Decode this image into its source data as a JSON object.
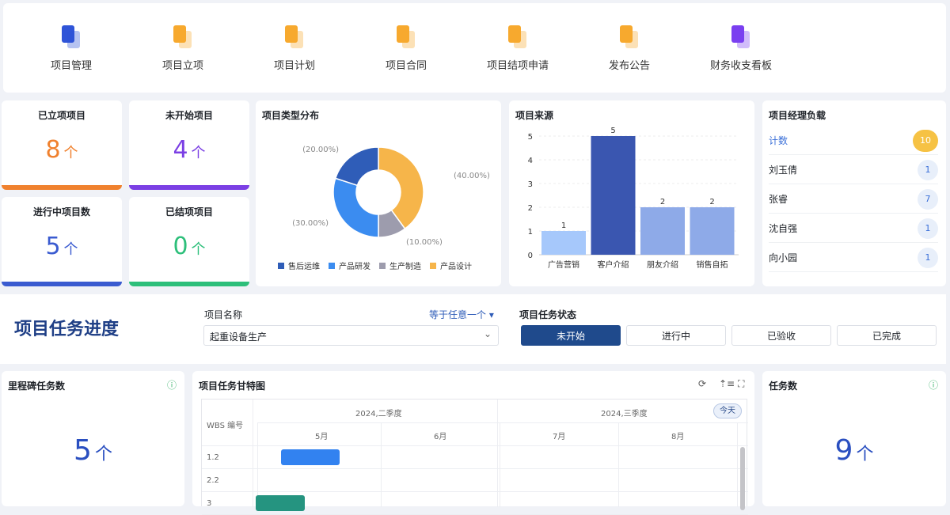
{
  "nav": [
    {
      "label": "项目管理",
      "icon": "project-management-icon",
      "color": "#2f54d8"
    },
    {
      "label": "项目立项",
      "icon": "project-initiation-icon",
      "color": "#f7a92e"
    },
    {
      "label": "项目计划",
      "icon": "project-plan-icon",
      "color": "#f7a92e"
    },
    {
      "label": "项目合同",
      "icon": "project-contract-icon",
      "color": "#f7a92e"
    },
    {
      "label": "项目结项申请",
      "icon": "project-closure-icon",
      "color": "#f7a92e"
    },
    {
      "label": "发布公告",
      "icon": "announcement-icon",
      "color": "#f7a92e"
    },
    {
      "label": "财务收支看板",
      "icon": "finance-dashboard-icon",
      "color": "#7a3ff0"
    }
  ],
  "stats": [
    {
      "title": "已立项项目",
      "value": "8",
      "unit": "个",
      "color": "#f0812e"
    },
    {
      "title": "未开始项目",
      "value": "4",
      "unit": "个",
      "color": "#7b3fe4"
    },
    {
      "title": "进行中项目数",
      "value": "5",
      "unit": "个",
      "color": "#3a5bd0"
    },
    {
      "title": "已结项项目",
      "value": "0",
      "unit": "个",
      "color": "#2dbf7a"
    }
  ],
  "pie": {
    "title": "项目类型分布"
  },
  "bar": {
    "title": "项目来源"
  },
  "managers": {
    "title": "项目经理负载",
    "total_label": "计数",
    "total": "10",
    "rows": [
      {
        "name": "刘玉倩",
        "value": "1"
      },
      {
        "name": "张睿",
        "value": "7"
      },
      {
        "name": "沈自强",
        "value": "1"
      },
      {
        "name": "向小园",
        "value": "1"
      }
    ]
  },
  "progress": {
    "title": "项目任务进度",
    "name_label": "项目名称",
    "operator": "等于任意一个",
    "name_value": "起重设备生产",
    "status_label": "项目任务状态",
    "statuses": [
      "未开始",
      "进行中",
      "已验收",
      "已完成"
    ]
  },
  "milestone": {
    "title": "里程碑任务数",
    "value": "5",
    "unit": "个"
  },
  "gantt": {
    "title": "项目任务甘特图",
    "wbs_header": "WBS 编号",
    "quarters": [
      "2024,二季度",
      "2024,三季度"
    ],
    "months": [
      "5月",
      "6月",
      "7月",
      "8月"
    ],
    "today": "今天",
    "rows": [
      "1.2",
      "2.2",
      "3"
    ]
  },
  "tasks": {
    "title": "任务数",
    "value": "9",
    "unit": "个"
  },
  "chart_data": [
    {
      "type": "pie",
      "title": "项目类型分布",
      "labels": [
        "产品设计",
        "生产制造",
        "产品研发",
        "售后运维"
      ],
      "values": [
        40,
        10,
        30,
        20
      ],
      "value_labels": [
        "(40.00%)",
        "(10.00%)",
        "(30.00%)",
        "(20.00%)"
      ],
      "colors": [
        "#f6b54a",
        "#9d9cad",
        "#3b8cf0",
        "#2f5db8"
      ],
      "legend": [
        "售后运维",
        "产品研发",
        "生产制造",
        "产品设计"
      ],
      "legend_colors": [
        "#2f5db8",
        "#3b8cf0",
        "#9d9cad",
        "#f6b54a"
      ],
      "legend_position": "bottom"
    },
    {
      "type": "bar",
      "title": "项目来源",
      "categories": [
        "广告营销",
        "客户介绍",
        "朋友介绍",
        "销售自拓"
      ],
      "values": [
        1,
        5,
        2,
        2
      ],
      "colors": [
        "#a6c8fb",
        "#3a56b0",
        "#8eaae8",
        "#8eaae8"
      ],
      "yticks": [
        "0",
        "1",
        "2",
        "3",
        "4",
        "5"
      ],
      "ylim": [
        0,
        5
      ]
    }
  ]
}
